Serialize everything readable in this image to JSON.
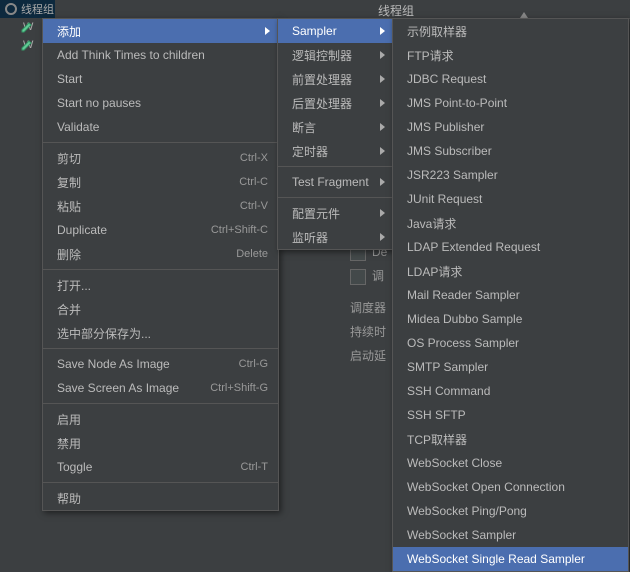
{
  "header": {
    "title": "线程组"
  },
  "tree": {
    "items": [
      {
        "label": "线程组"
      },
      {
        "label": "W"
      },
      {
        "label": "W"
      }
    ]
  },
  "form": {
    "de_prefix": "De",
    "tiao_prefix": "调",
    "scheduler": "调度器",
    "duration": "持续时",
    "delay": "启动延"
  },
  "menu1": {
    "add": "添加",
    "thinktime": "Add Think Times to children",
    "start": "Start",
    "startnp": "Start no pauses",
    "validate": "Validate",
    "cut": "剪切",
    "cut_sc": "Ctrl-X",
    "copy": "复制",
    "copy_sc": "Ctrl-C",
    "paste": "粘贴",
    "paste_sc": "Ctrl-V",
    "duplicate": "Duplicate",
    "duplicate_sc": "Ctrl+Shift-C",
    "delete": "删除",
    "delete_sc": "Delete",
    "open": "打开...",
    "merge": "合并",
    "saveas": "选中部分保存为...",
    "snode": "Save Node As Image",
    "snode_sc": "Ctrl-G",
    "sscreen": "Save Screen As Image",
    "sscreen_sc": "Ctrl+Shift-G",
    "enable": "启用",
    "disable": "禁用",
    "toggle": "Toggle",
    "toggle_sc": "Ctrl-T",
    "help": "帮助"
  },
  "menu2": {
    "sampler": "Sampler",
    "logic": "逻辑控制器",
    "pre": "前置处理器",
    "post": "后置处理器",
    "assert": "断言",
    "timer": "定时器",
    "frag": "Test Fragment",
    "config": "配置元件",
    "listener": "监听器"
  },
  "menu3": {
    "items": [
      "示例取样器",
      "FTP请求",
      "JDBC Request",
      "JMS Point-to-Point",
      "JMS Publisher",
      "JMS Subscriber",
      "JSR223 Sampler",
      "JUnit Request",
      "Java请求",
      "LDAP Extended Request",
      "LDAP请求",
      "Mail Reader Sampler",
      "Midea Dubbo Sample",
      "OS Process Sampler",
      "SMTP Sampler",
      "SSH Command",
      "SSH SFTP",
      "TCP取样器",
      "WebSocket Close",
      "WebSocket Open Connection",
      "WebSocket Ping/Pong",
      "WebSocket Sampler",
      "WebSocket Single Read Sampler"
    ]
  }
}
